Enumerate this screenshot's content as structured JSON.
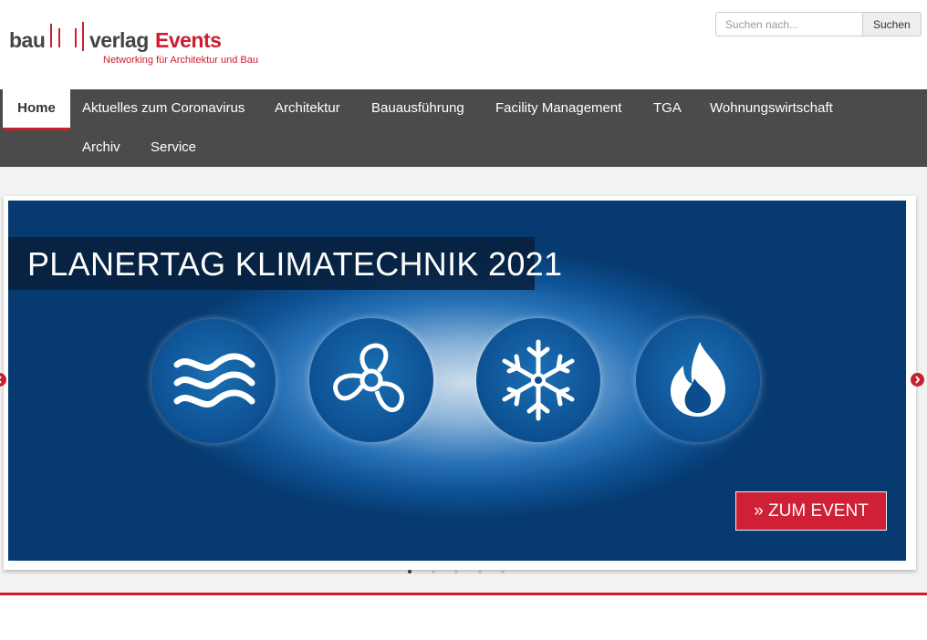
{
  "logo": {
    "part_bau": "bau",
    "part_verlag": "verlag",
    "part_events": "Events",
    "tagline": "Networking für Architektur und Bau"
  },
  "search": {
    "placeholder": "Suchen nach...",
    "button_label": "Suchen"
  },
  "nav": {
    "items": [
      {
        "label": "Home",
        "active": true
      },
      {
        "label": "Aktuelles zum Coronavirus"
      },
      {
        "label": "Architektur"
      },
      {
        "label": "Bauausführung"
      },
      {
        "label": "Facility Management"
      },
      {
        "label": "TGA"
      },
      {
        "label": "Wohnungswirtschaft"
      },
      {
        "label": "Archiv"
      },
      {
        "label": "Service"
      }
    ]
  },
  "slider": {
    "title": "PLANERTAG KLIMATECHNIK 2021",
    "cta_label": "» ZUM EVENT",
    "icons": [
      "air-waves-icon",
      "fan-icon",
      "snowflake-icon",
      "flame-icon"
    ],
    "active_slide": 1,
    "slide_count": 5
  },
  "colors": {
    "accent": "#c9202f",
    "nav_bg": "#4b4b4b",
    "slide_blue": "#0f5497"
  }
}
